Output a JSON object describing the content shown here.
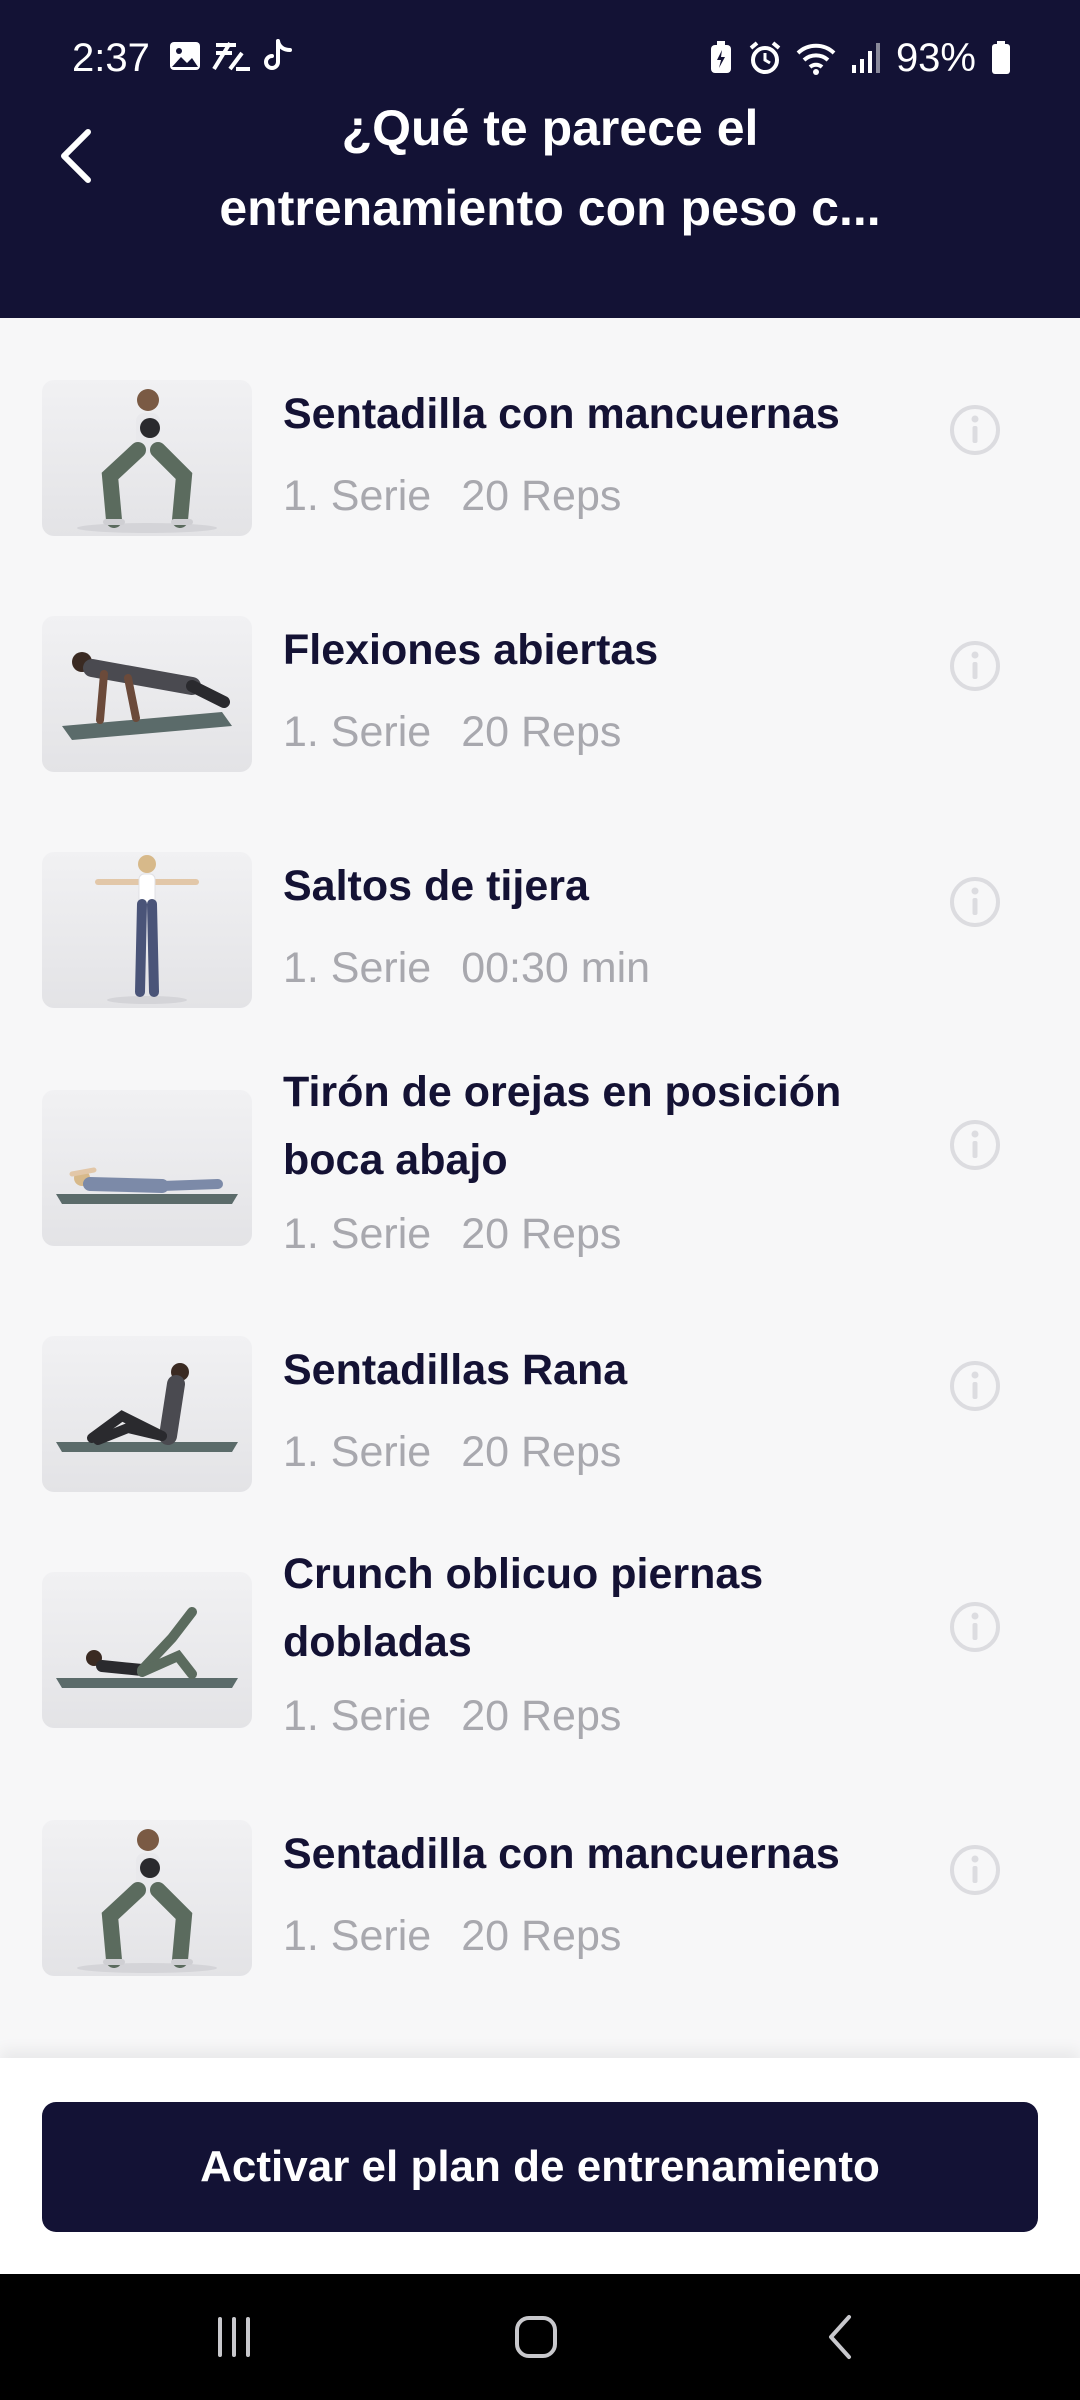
{
  "status_bar": {
    "time": "2:37",
    "battery_percent": "93%",
    "left_icons": [
      "image-icon",
      "notification-icon",
      "tiktok-icon"
    ],
    "right_icons": [
      "battery-saver-icon",
      "alarm-icon",
      "wifi-icon",
      "signal-icon",
      "battery-icon"
    ]
  },
  "header": {
    "title_line1": "¿Qué te parece el",
    "title_line2": "entrenamiento con peso c..."
  },
  "exercises": [
    {
      "name": "Sentadilla con mancuernas",
      "sets": "1. Serie",
      "amount": "20 Reps",
      "image": "dumbbell-squat"
    },
    {
      "name": "Flexiones abiertas",
      "sets": "1. Serie",
      "amount": "20 Reps",
      "image": "push-up"
    },
    {
      "name": "Saltos de tijera",
      "sets": "1. Serie",
      "amount": "00:30 min",
      "image": "jumping-jack"
    },
    {
      "name": "Tirón de orejas en posición boca abajo",
      "sets": "1. Serie",
      "amount": "20 Reps",
      "image": "prone-pull"
    },
    {
      "name": "Sentadillas Rana",
      "sets": "1. Serie",
      "amount": "20 Reps",
      "image": "frog-sit-up"
    },
    {
      "name": "Crunch oblicuo piernas dobladas",
      "sets": "1. Serie",
      "amount": "20 Reps",
      "image": "oblique-crunch"
    },
    {
      "name": "Sentadilla con mancuernas",
      "sets": "1. Serie",
      "amount": "20 Reps",
      "image": "dumbbell-squat"
    }
  ],
  "cta": {
    "label": "Activar el plan de entrenamiento"
  },
  "nav_bar": {
    "buttons": [
      "recent-apps-icon",
      "home-icon",
      "back-icon"
    ]
  },
  "colors": {
    "primary": "#131235",
    "background": "#f7f7f8",
    "title_text": "#141234",
    "meta_text": "#a8a8ae",
    "white": "#ffffff"
  }
}
